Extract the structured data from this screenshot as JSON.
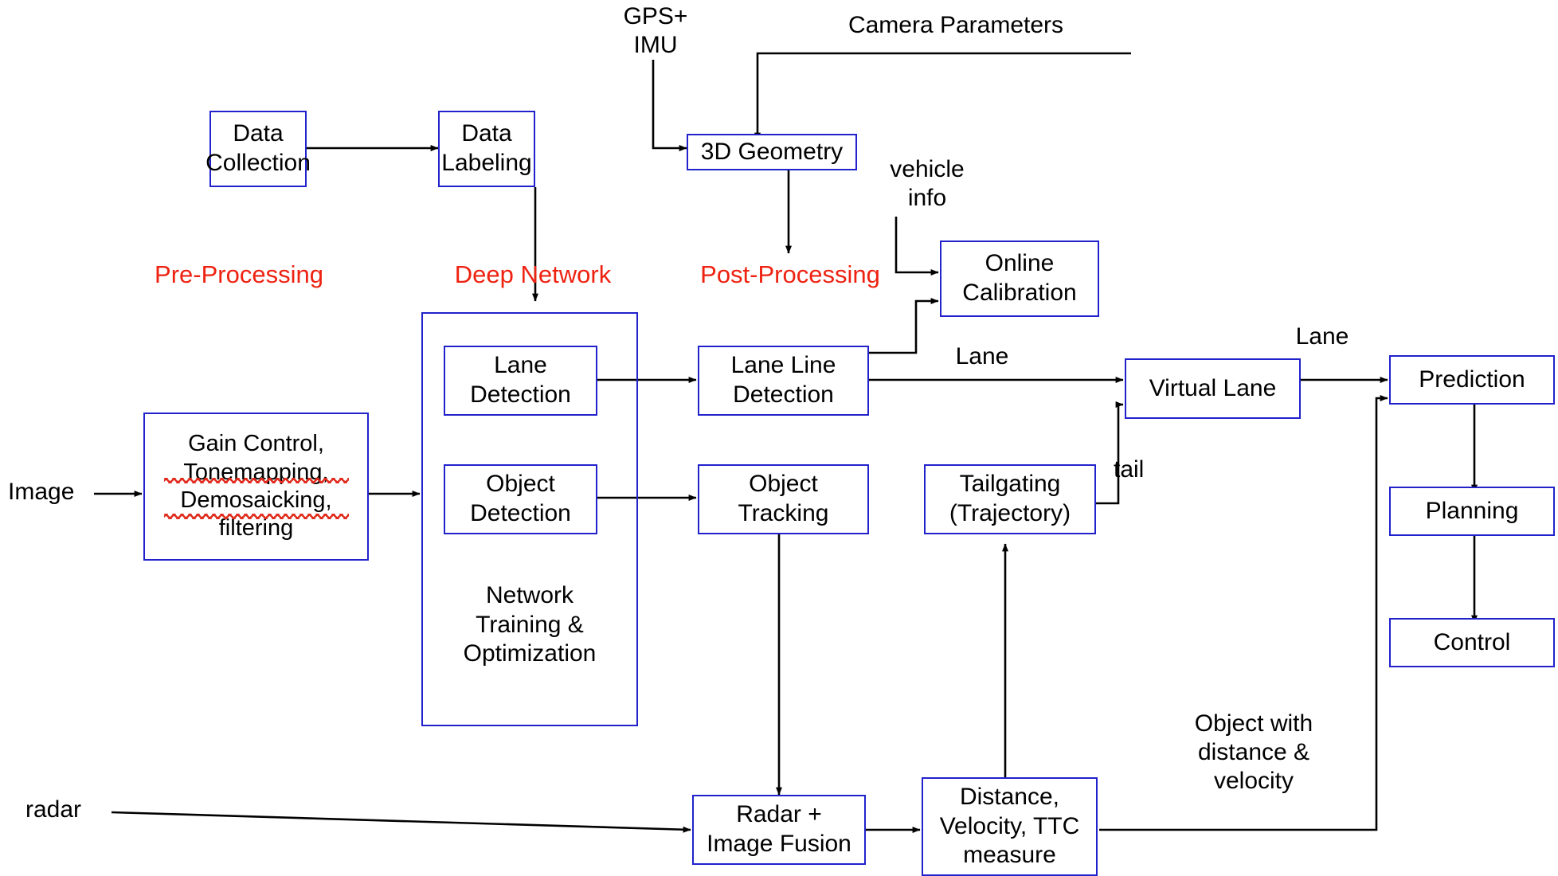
{
  "diagram": {
    "title": "Camera perception pipeline for autonomous driving",
    "colors": {
      "box_border": "#2222cc",
      "stage_label": "#ee2211",
      "wire": "#000000",
      "spellcheck_underline": "#e02b1d",
      "background": "#ffffff"
    },
    "stage_labels": [
      {
        "id": "pre_processing",
        "text": "Pre-Processing"
      },
      {
        "id": "deep_network",
        "text": "Deep Network"
      },
      {
        "id": "post_processing",
        "text": "Post-Processing"
      }
    ],
    "nodes": [
      {
        "id": "data_collection",
        "text": "Data\nCollection"
      },
      {
        "id": "data_labeling",
        "text": "Data\nLabeling"
      },
      {
        "id": "geometry_3d",
        "text": "3D Geometry"
      },
      {
        "id": "online_calibration",
        "text": "Online\nCalibration"
      },
      {
        "id": "gain_control",
        "text": "Gain Control,\nTonemapping,\nDemosaicking,\nfiltering"
      },
      {
        "id": "lane_detection",
        "text": "Lane\nDetection"
      },
      {
        "id": "object_detection",
        "text": "Object\nDetection"
      },
      {
        "id": "lane_line_detection",
        "text": "Lane Line\nDetection"
      },
      {
        "id": "object_tracking",
        "text": "Object\nTracking"
      },
      {
        "id": "tailgating",
        "text": "Tailgating\n(Trajectory)"
      },
      {
        "id": "virtual_lane",
        "text": "Virtual Lane"
      },
      {
        "id": "prediction",
        "text": "Prediction"
      },
      {
        "id": "planning",
        "text": "Planning"
      },
      {
        "id": "control",
        "text": "Control"
      },
      {
        "id": "radar_image_fusion",
        "text": "Radar +\nImage Fusion"
      },
      {
        "id": "distance_velocity_ttc",
        "text": "Distance,\nVelocity, TTC\nmeasure"
      }
    ],
    "group": {
      "id": "deep_network_group",
      "caption": "Network\nTraining &\nOptimization"
    },
    "edge_labels": [
      {
        "id": "gps_imu",
        "text": "GPS+\nIMU"
      },
      {
        "id": "camera_parameters",
        "text": "Camera Parameters"
      },
      {
        "id": "vehicle_info",
        "text": "vehicle\ninfo"
      },
      {
        "id": "lane_in",
        "text": "Lane"
      },
      {
        "id": "lane_out",
        "text": "Lane"
      },
      {
        "id": "tail",
        "text": "tail"
      },
      {
        "id": "image_input",
        "text": "Image"
      },
      {
        "id": "radar_input",
        "text": "radar"
      },
      {
        "id": "object_with_distance_velocity",
        "text": "Object with\ndistance &\nvelocity"
      }
    ]
  },
  "chart_data": {
    "type": "diagram",
    "title": "Camera perception pipeline for autonomous driving",
    "nodes": [
      "Data Collection",
      "Data Labeling",
      "3D Geometry",
      "Online Calibration",
      "Gain Control, Tonemapping, Demosaicking, filtering",
      "Lane Detection",
      "Object Detection",
      "Lane Line Detection",
      "Object Tracking",
      "Tailgating (Trajectory)",
      "Virtual Lane",
      "Prediction",
      "Planning",
      "Control",
      "Radar + Image Fusion",
      "Distance, Velocity, TTC measure"
    ],
    "edges": [
      {
        "from": "Data Collection",
        "to": "Data Labeling",
        "label": ""
      },
      {
        "from": "Data Labeling",
        "to": "Deep Network group",
        "label": ""
      },
      {
        "from": "GPS+IMU",
        "to": "3D Geometry",
        "label": "GPS+ IMU"
      },
      {
        "from": "Online Calibration",
        "to": "3D Geometry",
        "label": "Camera Parameters"
      },
      {
        "from": "3D Geometry",
        "to": "Post-Processing",
        "label": ""
      },
      {
        "from": "vehicle info",
        "to": "Online Calibration",
        "label": "vehicle info"
      },
      {
        "from": "Lane Line Detection",
        "to": "Online Calibration",
        "label": ""
      },
      {
        "from": "Image",
        "to": "Gain Control, Tonemapping, Demosaicking, filtering",
        "label": "Image"
      },
      {
        "from": "Gain Control, Tonemapping, Demosaicking, filtering",
        "to": "Deep Network group",
        "label": ""
      },
      {
        "from": "Lane Detection",
        "to": "Lane Line Detection",
        "label": ""
      },
      {
        "from": "Object Detection",
        "to": "Object Tracking",
        "label": ""
      },
      {
        "from": "Lane Line Detection",
        "to": "Virtual Lane",
        "label": "Lane"
      },
      {
        "from": "Tailgating (Trajectory)",
        "to": "Virtual Lane",
        "label": "tail"
      },
      {
        "from": "Virtual Lane",
        "to": "Prediction",
        "label": "Lane"
      },
      {
        "from": "Prediction",
        "to": "Planning",
        "label": ""
      },
      {
        "from": "Planning",
        "to": "Control",
        "label": ""
      },
      {
        "from": "Object Tracking",
        "to": "Radar + Image Fusion",
        "label": ""
      },
      {
        "from": "radar",
        "to": "Radar + Image Fusion",
        "label": "radar"
      },
      {
        "from": "Radar + Image Fusion",
        "to": "Distance, Velocity, TTC measure",
        "label": ""
      },
      {
        "from": "Distance, Velocity, TTC measure",
        "to": "Tailgating (Trajectory)",
        "label": ""
      },
      {
        "from": "Distance, Velocity, TTC measure",
        "to": "Prediction",
        "label": "Object with distance & velocity"
      }
    ],
    "groups": [
      {
        "name": "Deep Network",
        "caption": "Network Training & Optimization",
        "members": [
          "Lane Detection",
          "Object Detection"
        ]
      }
    ],
    "stages": [
      "Pre-Processing",
      "Deep Network",
      "Post-Processing"
    ]
  }
}
